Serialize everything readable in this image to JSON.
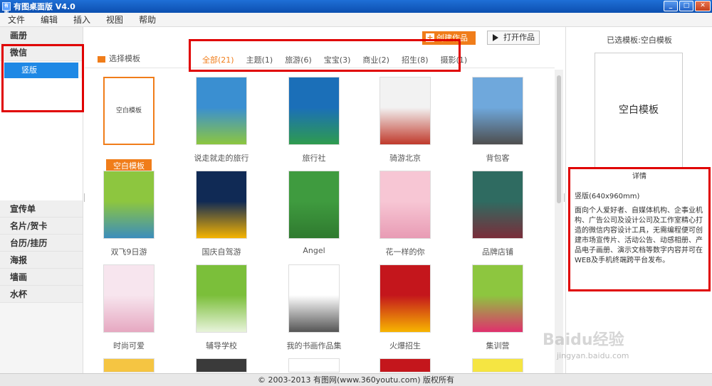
{
  "window": {
    "title": "有图桌面版 V4.0",
    "app_icon_text": "有图"
  },
  "menu": [
    "文件",
    "编辑",
    "插入",
    "视图",
    "帮助"
  ],
  "sidebar": {
    "top": [
      "画册",
      "微信"
    ],
    "sub": "竖版",
    "bottom": [
      "宣传单",
      "名片/贺卡",
      "台历/挂历",
      "海报",
      "墙画",
      "水杯"
    ]
  },
  "toolbar": {
    "create": "创建作品",
    "open": "打开作品"
  },
  "selector": {
    "label": "选择模板",
    "filters": [
      "全部(21)",
      "主题(1)",
      "旅游(6)",
      "宝宝(3)",
      "商业(2)",
      "招生(8)",
      "摄影(1)"
    ]
  },
  "templates": [
    {
      "label": "空白模板",
      "thumb_text": "空白模板",
      "selected": true
    },
    {
      "label": "说走就走的旅行",
      "top": "#3a8fd1",
      "bottom": "#8cc63f"
    },
    {
      "label": "旅行社",
      "top": "#1b6fb8",
      "bottom": "#2e9b4e"
    },
    {
      "label": "骑游北京",
      "top": "#f2f2f2",
      "bottom": "#c0392b"
    },
    {
      "label": "背包客",
      "top": "#6fa8dc",
      "bottom": "#4e4e4e"
    },
    {
      "label": "双飞9日游",
      "top": "#8dc63f",
      "bottom": "#3c8dbc"
    },
    {
      "label": "国庆自驾游",
      "top": "#102a55",
      "bottom": "#f5b400"
    },
    {
      "label": "Angel",
      "top": "#3f9b3f",
      "bottom": "#2f7a2f"
    },
    {
      "label": "花一样的你",
      "top": "#f7c6d4",
      "bottom": "#e89bb4"
    },
    {
      "label": "品牌店铺",
      "top": "#2f6b61",
      "bottom": "#7a2d3a"
    },
    {
      "label": "时尚可爱",
      "top": "#f7e5ee",
      "bottom": "#e6a8c1"
    },
    {
      "label": "辅导学校",
      "top": "#7bbf3a",
      "bottom": "#e8f3db"
    },
    {
      "label": "我的书画作品集",
      "top": "#ffffff",
      "bottom": "#555555"
    },
    {
      "label": "火爆招生",
      "top": "#c4161c",
      "bottom": "#f7b500"
    },
    {
      "label": "集训营",
      "top": "#8dc63f",
      "bottom": "#e0306d"
    }
  ],
  "right_panel": {
    "title": "已选模板:空白模板",
    "preview_text": "空白模板",
    "detail_heading": "详情",
    "size_text": "竖版(640x960mm)",
    "description": "面向个人爱好者、自媒体机构、企事业机构、广告公司及设计公司及工作室精心打造的微信内容设计工具，无需编程便可创建市场宣传片、活动公告、动感相册、产品电子画册、演示文档等数字内容并可在WEB及手机终端跨平台发布。"
  },
  "footer": "© 2003-2013 有图网(www.360youtu.com) 版权所有",
  "watermark": {
    "main": "Baidu经验",
    "sub": "jingyan.baidu.com"
  },
  "colors": {
    "accent": "#f07d1a",
    "highlight": "#1e88e5",
    "annotation_red": "#e00000"
  }
}
